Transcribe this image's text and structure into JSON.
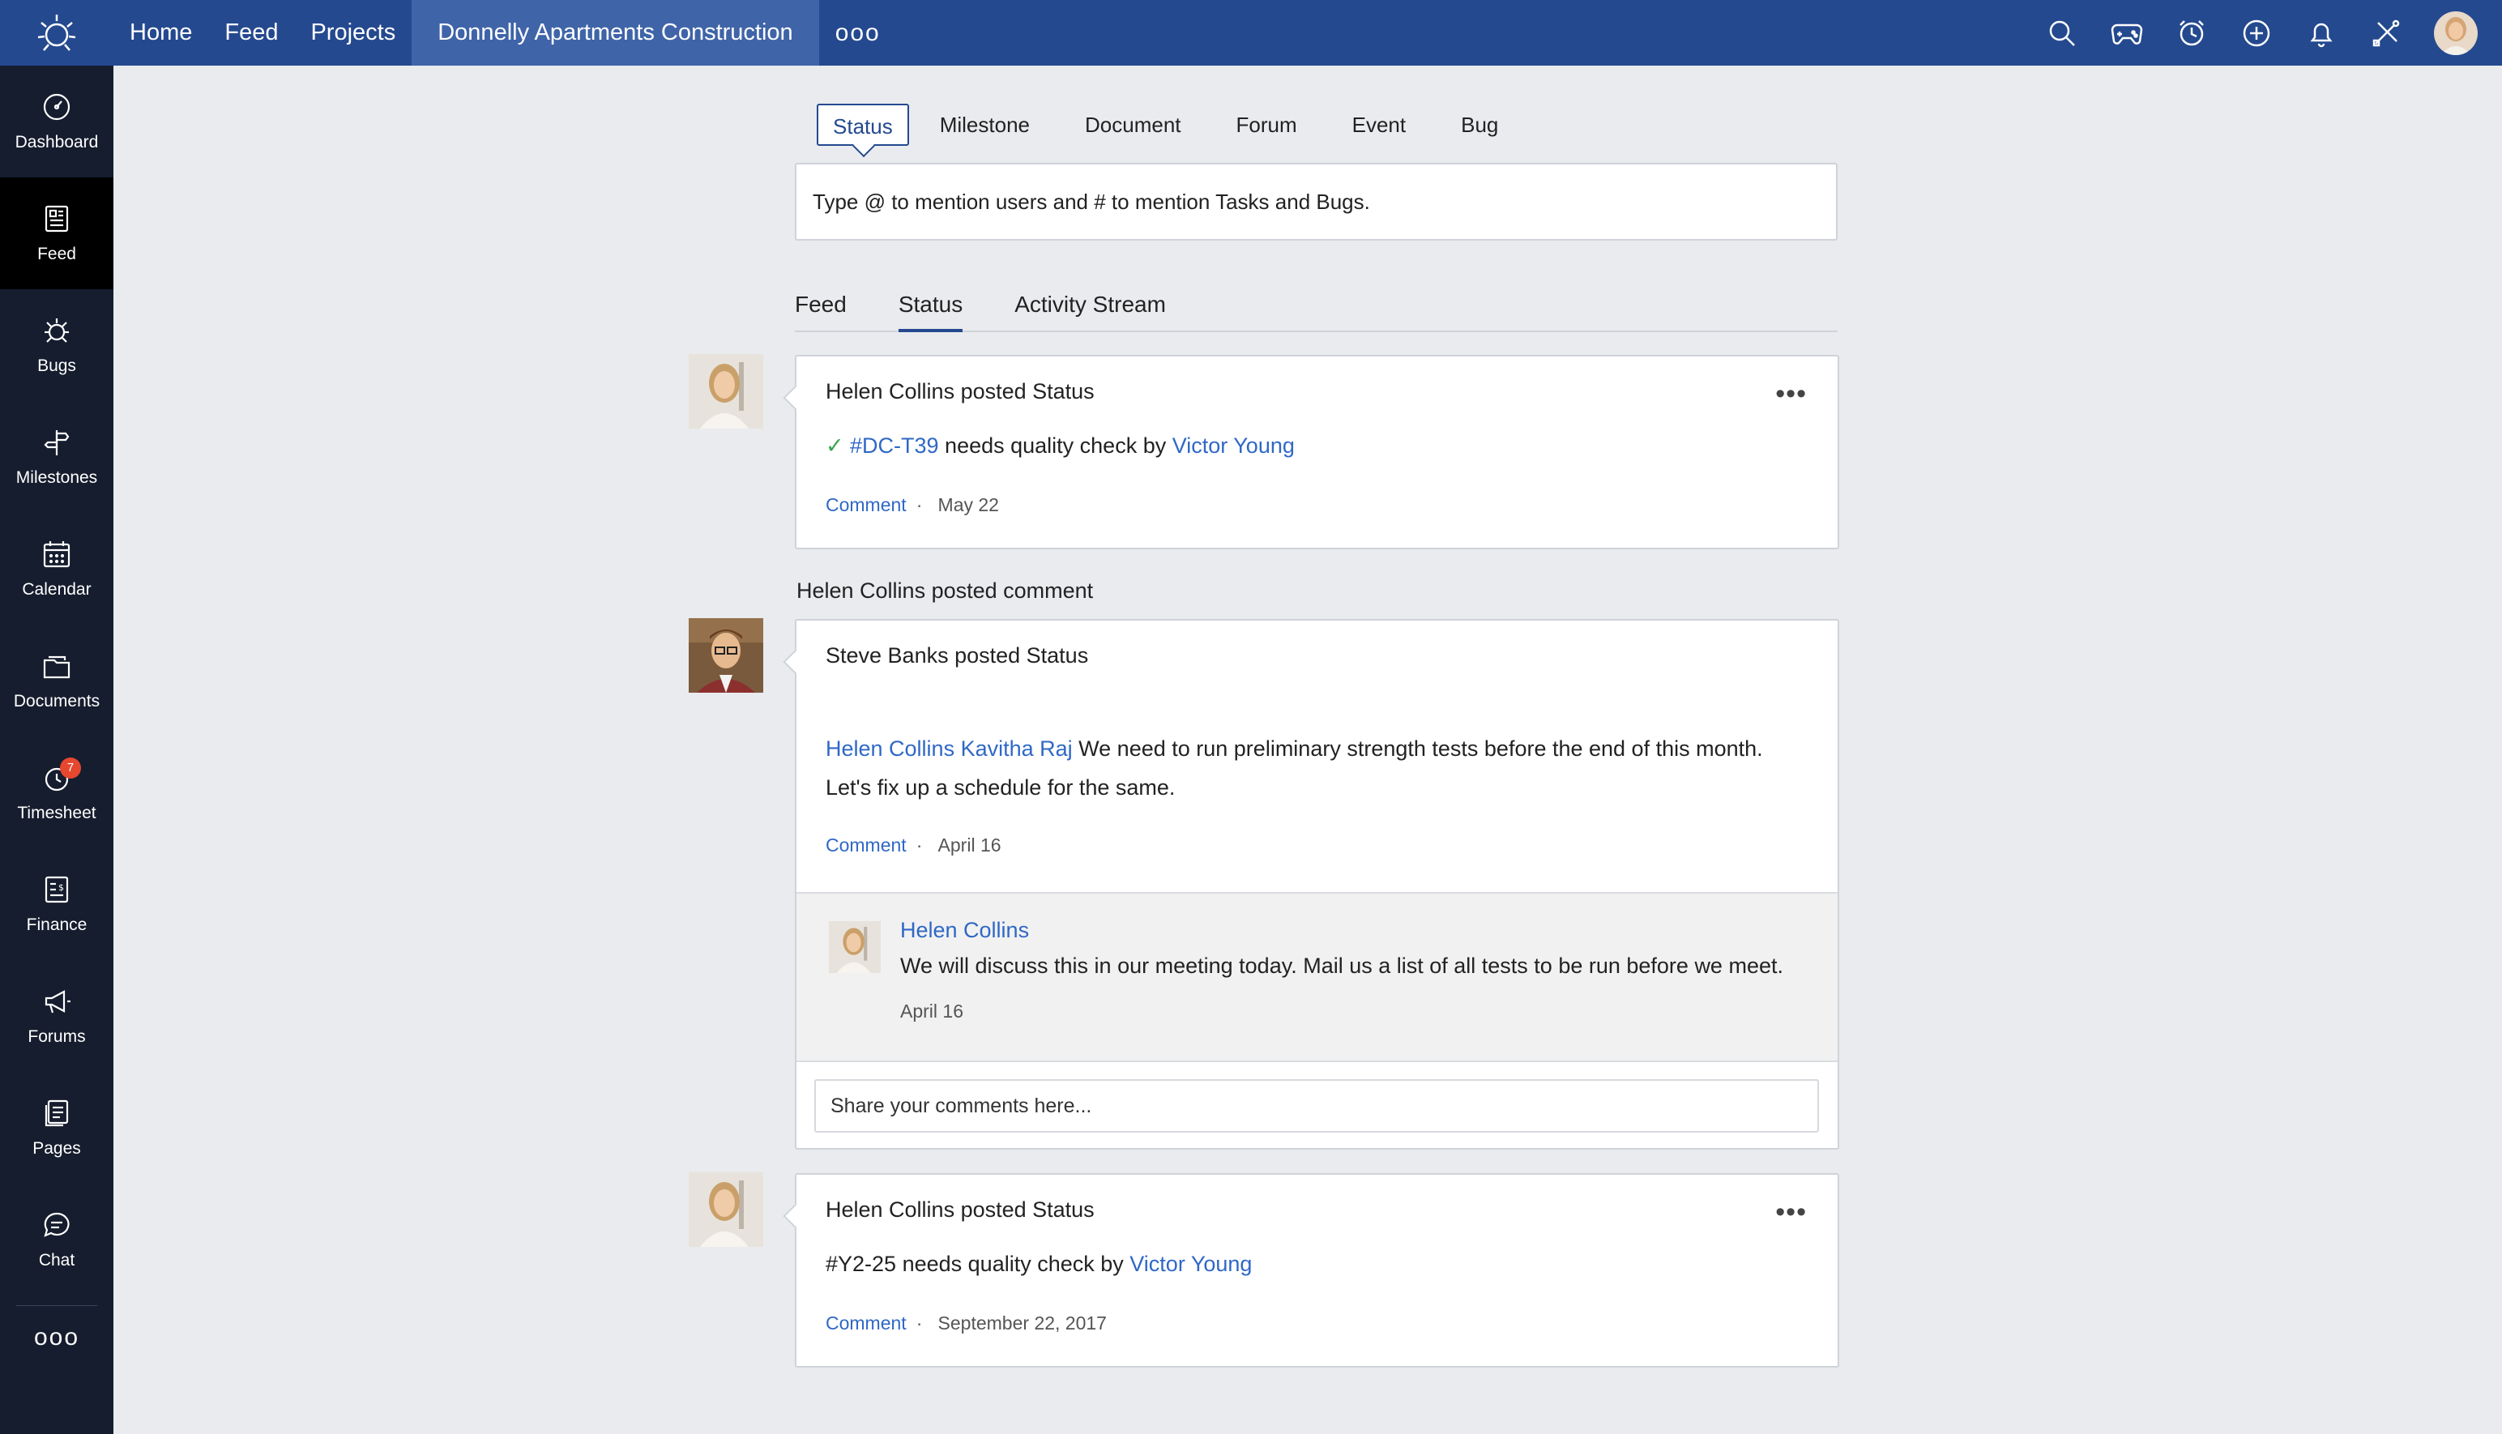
{
  "topbar": {
    "nav": [
      "Home",
      "Feed",
      "Projects"
    ],
    "project": "Donnelly Apartments Construction",
    "more": "ooo",
    "icons": [
      "search-icon",
      "gamepad-icon",
      "alarm-clock-icon",
      "plus-circle-icon",
      "bell-icon",
      "tools-icon"
    ],
    "bar_color": "#24498f"
  },
  "sidebar": {
    "items": [
      {
        "label": "Dashboard",
        "icon": "dashboard-icon"
      },
      {
        "label": "Feed",
        "icon": "feed-icon"
      },
      {
        "label": "Bugs",
        "icon": "bug-icon"
      },
      {
        "label": "Milestones",
        "icon": "signpost-icon"
      },
      {
        "label": "Calendar",
        "icon": "calendar-icon"
      },
      {
        "label": "Documents",
        "icon": "folder-icon"
      },
      {
        "label": "Timesheet",
        "icon": "timer-icon",
        "badge": "7"
      },
      {
        "label": "Finance",
        "icon": "finance-icon"
      },
      {
        "label": "Forums",
        "icon": "megaphone-icon"
      },
      {
        "label": "Pages",
        "icon": "pages-icon"
      },
      {
        "label": "Chat",
        "icon": "chat-icon"
      }
    ],
    "more": "ooo"
  },
  "composer": {
    "tabs": [
      "Status",
      "Milestone",
      "Document",
      "Forum",
      "Event",
      "Bug"
    ],
    "placeholder": "Type @ to mention users and # to mention Tasks and Bugs."
  },
  "stream_tabs": [
    "Feed",
    "Status",
    "Activity Stream"
  ],
  "posts": [
    {
      "title": "Helen Collins posted Status",
      "tag": "#DC-T39",
      "text": "needs quality check by",
      "mention": "Victor Young",
      "comment": "Comment",
      "sep": "·",
      "date": "May 22"
    },
    {
      "context": "Helen Collins posted comment",
      "title": "Steve Banks posted Status",
      "mentions": "Helen Collins Kavitha Raj",
      "text1": "We need to run preliminary strength tests before the end of this month.",
      "text2": "Let's fix up a schedule for the same.",
      "comment": "Comment",
      "sep": "·",
      "date": "April 16",
      "reply": {
        "name": "Helen Collins",
        "text": "We will discuss this in our meeting today. Mail us a list of all tests to be run before we meet.",
        "date": "April 16"
      },
      "comment_placeholder": "Share your comments here..."
    },
    {
      "title": "Helen Collins posted Status",
      "tag": "#Y2-25",
      "text": "needs quality check by",
      "mention": "Victor Young",
      "comment": "Comment",
      "sep": "·",
      "date": "September 22, 2017"
    }
  ]
}
